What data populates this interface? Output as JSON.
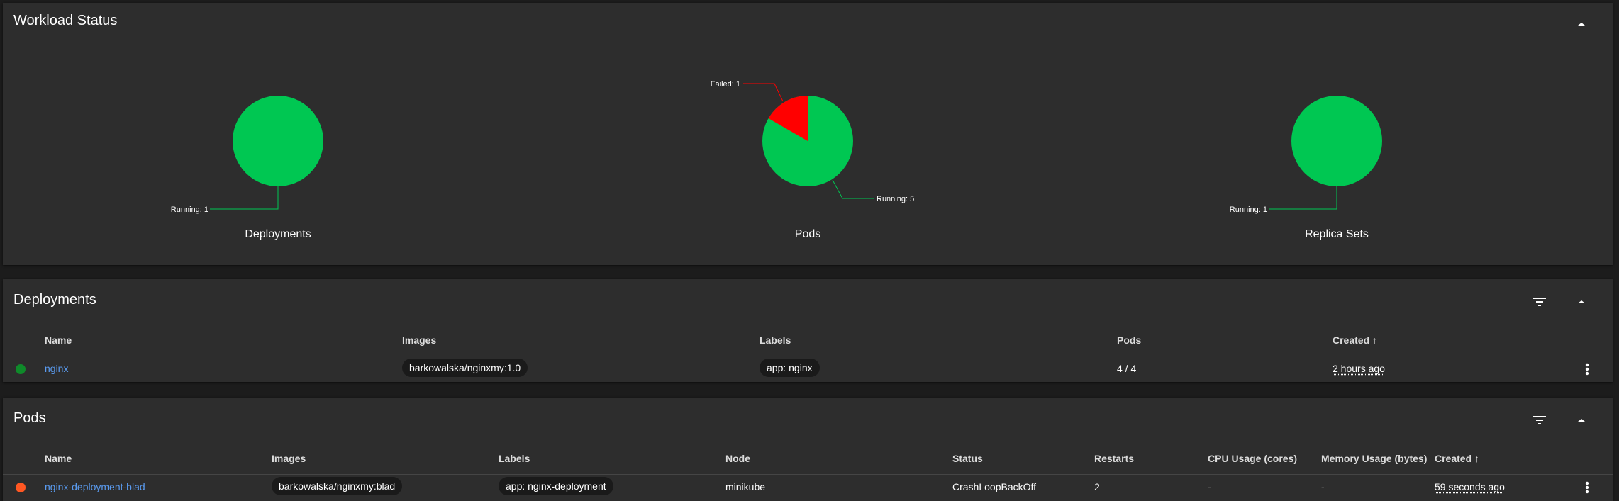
{
  "workload": {
    "title": "Workload Status",
    "charts": [
      {
        "caption": "Deployments",
        "slices": [
          {
            "label": "Running: 1",
            "value": 1,
            "color": "#00c752"
          }
        ]
      },
      {
        "caption": "Pods",
        "slices": [
          {
            "label": "Running: 5",
            "value": 5,
            "color": "#00c752"
          },
          {
            "label": "Failed: 1",
            "value": 1,
            "color": "#ff0000"
          }
        ]
      },
      {
        "caption": "Replica Sets",
        "slices": [
          {
            "label": "Running: 1",
            "value": 1,
            "color": "#00c752"
          }
        ]
      }
    ]
  },
  "deployments": {
    "title": "Deployments",
    "columns": {
      "name": "Name",
      "images": "Images",
      "labels": "Labels",
      "pods": "Pods",
      "created": "Created"
    },
    "sort_arrow": "↑",
    "rows": [
      {
        "status_color": "#0f8a2a",
        "name": "nginx",
        "image": "barkowalska/nginxmy:1.0",
        "label": "app: nginx",
        "pods": "4 / 4",
        "created": "2 hours ago"
      }
    ]
  },
  "pods": {
    "title": "Pods",
    "columns": {
      "name": "Name",
      "images": "Images",
      "labels": "Labels",
      "node": "Node",
      "status": "Status",
      "restarts": "Restarts",
      "cpu": "CPU Usage (cores)",
      "memory": "Memory Usage (bytes)",
      "created": "Created"
    },
    "sort_arrow": "↑",
    "rows": [
      {
        "status_color": "#ff5722",
        "name": "nginx-deployment-blad",
        "image": "barkowalska/nginxmy:blad",
        "label": "app: nginx-deployment",
        "node": "minikube",
        "status": "CrashLoopBackOff",
        "restarts": "2",
        "cpu": "-",
        "memory": "-",
        "created": "59 seconds ago"
      }
    ]
  },
  "icons": {
    "collapse": "chevron-up-icon",
    "filter": "filter-icon",
    "more": "more-vert-icon",
    "sort": "arrow-upward-icon"
  }
}
